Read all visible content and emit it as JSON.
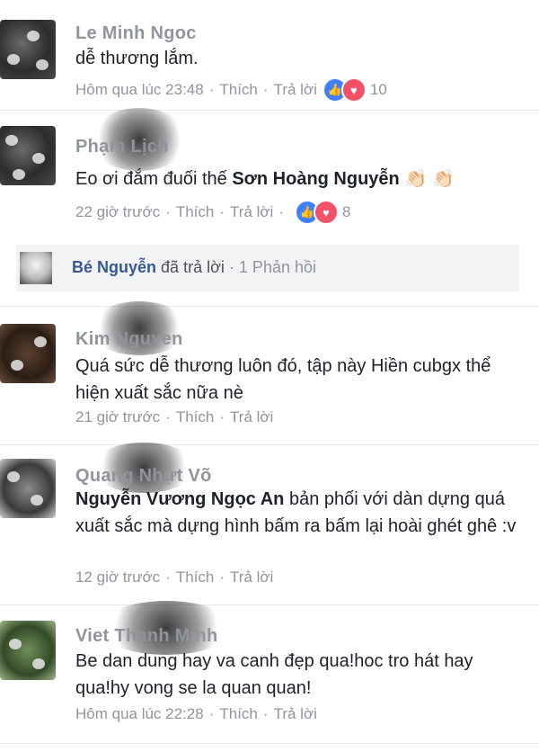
{
  "comments": [
    {
      "name": "Le Minh Ngoc",
      "text": "dễ thương lắm.",
      "time": "Hôm qua lúc 23:48",
      "like_label": "Thích",
      "reply_label": "Trả lời",
      "reactions": "10"
    },
    {
      "name": "Phạm Lịch",
      "text_pre": "Eo ơi đắm đuối thế ",
      "mention": "Sơn Hoàng Nguyễn",
      "emoji": "👏🏻 👏🏻",
      "time": "22 giờ trước",
      "like_label": "Thích",
      "reply_label": "Trả lời",
      "reactions": "8"
    },
    {
      "name": "Kim Nguyen",
      "text": "Quá sức dễ thương luôn đó, tập này Hiền cubgx thể hiện xuất sắc nữa nè",
      "time": "21 giờ trước",
      "like_label": "Thích",
      "reply_label": "Trả lời"
    },
    {
      "name": "Quang Nhựt Võ",
      "mention": "Nguyễn Vương Ngọc An",
      "text_post": " bản phối với dàn dựng quá xuất sắc mà dựng hình bấm ra bấm lại hoài ghét ghê :v",
      "time": "12 giờ trước",
      "like_label": "Thích",
      "reply_label": "Trả lời"
    },
    {
      "name": "Viet Thanh Minh",
      "text": "Be dan dung hay va canh đẹp qua!hoc tro hát hay qua!hy vong se la quan quan!",
      "time": "Hôm qua lúc 22:28",
      "like_label": "Thích",
      "reply_label": "Trả lời"
    }
  ],
  "reply_bar": {
    "author": "Bé Nguyễn",
    "action": "đã trả lời",
    "count": "1 Phản hồi"
  },
  "icons": {
    "like": "like-icon",
    "love": "love-icon"
  },
  "colors": {
    "like": "#4080ff",
    "love": "#f25268",
    "meta": "#90949c",
    "mention": "#1d2129"
  }
}
